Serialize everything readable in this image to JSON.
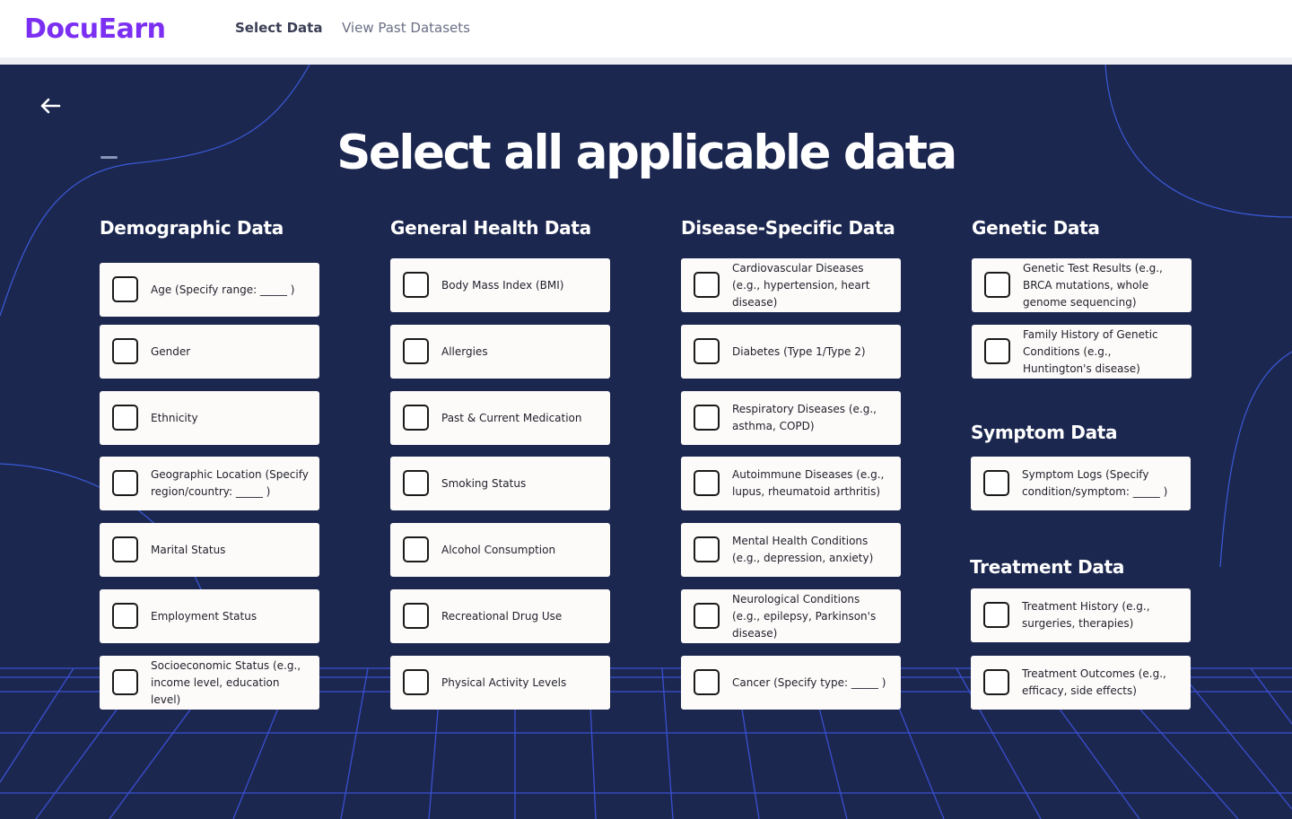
{
  "app": {
    "logo_text": "DocuEarn",
    "brand_color": "#7b2ff2",
    "nav": {
      "select_data": "Select Data",
      "view_past": "View Past Datasets"
    }
  },
  "page": {
    "title": "Select all applicable data",
    "back_icon": "arrow-left-icon",
    "background_color": "#1c2750",
    "grid_line_color": "#3a4fd0"
  },
  "columns": {
    "demographic": {
      "heading": "Demographic Data",
      "items": [
        "Age (Specify range: _____ )",
        "Gender",
        "Ethnicity",
        "Geographic Location (Specify region/country: _____ )",
        "Marital Status",
        "Employment Status",
        "Socioeconomic Status (e.g., income level, education level)"
      ]
    },
    "general": {
      "heading": "General Health Data",
      "items": [
        "Body Mass Index (BMI)",
        "Allergies",
        "Past & Current Medication",
        "Smoking Status",
        "Alcohol Consumption",
        "Recreational Drug Use",
        "Physical Activity Levels"
      ]
    },
    "disease": {
      "heading": "Disease-Specific Data",
      "items": [
        "Cardiovascular Diseases (e.g., hypertension, heart disease)",
        "Diabetes (Type 1/Type 2)",
        "Respiratory Diseases (e.g., asthma, COPD)",
        "Autoimmune Diseases (e.g., lupus, rheumatoid arthritis)",
        "Mental Health Conditions (e.g., depression, anxiety)",
        "Neurological Conditions (e.g., epilepsy, Parkinson's disease)",
        "Cancer (Specify type: _____ )"
      ]
    },
    "genetic": {
      "heading": "Genetic Data",
      "items": [
        "Genetic Test Results (e.g., BRCA mutations, whole genome sequencing)",
        "Family History of Genetic Conditions (e.g., Huntington's disease)"
      ]
    },
    "symptom": {
      "heading": "Symptom Data",
      "items": [
        "Symptom Logs (Specify condition/symptom: _____ )"
      ]
    },
    "treatment": {
      "heading": "Treatment Data",
      "items": [
        "Treatment History (e.g., surgeries, therapies)",
        "Treatment Outcomes (e.g., efficacy, side effects)"
      ]
    }
  }
}
